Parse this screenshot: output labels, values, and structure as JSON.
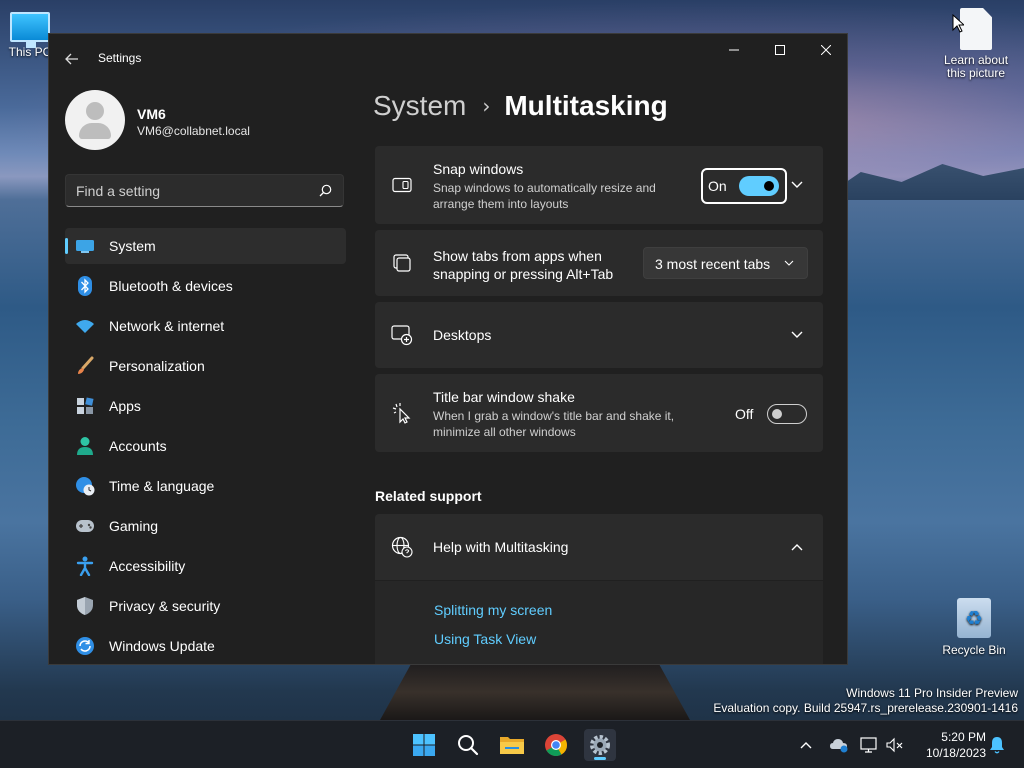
{
  "desktop": {
    "icons": [
      {
        "label": "This PC"
      },
      {
        "label": "Learn about this picture"
      },
      {
        "label": "Recycle Bin"
      }
    ],
    "watermark_line1": "Windows 11 Pro Insider Preview",
    "watermark_line2": "Evaluation copy. Build 25947.rs_prerelease.230901-1416"
  },
  "window": {
    "title": "Settings",
    "profile": {
      "name": "VM6",
      "email": "VM6@collabnet.local"
    },
    "search": {
      "placeholder": "Find a setting"
    },
    "nav": [
      {
        "label": "System",
        "icon": "monitor-icon",
        "active": true
      },
      {
        "label": "Bluetooth & devices",
        "icon": "bluetooth-icon"
      },
      {
        "label": "Network & internet",
        "icon": "wifi-icon"
      },
      {
        "label": "Personalization",
        "icon": "paintbrush-icon"
      },
      {
        "label": "Apps",
        "icon": "apps-icon"
      },
      {
        "label": "Accounts",
        "icon": "person-icon"
      },
      {
        "label": "Time & language",
        "icon": "globe-clock-icon"
      },
      {
        "label": "Gaming",
        "icon": "gamepad-icon"
      },
      {
        "label": "Accessibility",
        "icon": "accessibility-icon"
      },
      {
        "label": "Privacy & security",
        "icon": "shield-icon"
      },
      {
        "label": "Windows Update",
        "icon": "update-icon"
      }
    ],
    "breadcrumb": {
      "parent": "System",
      "separator": "›",
      "current": "Multitasking"
    },
    "settings": {
      "snap": {
        "title": "Snap windows",
        "desc_line1": "Snap windows to automatically resize and",
        "desc_line2": "arrange them into layouts",
        "state_label": "On",
        "enabled": true
      },
      "tabs": {
        "title_line1": "Show tabs from apps when",
        "title_line2": "snapping or pressing Alt+Tab",
        "selected": "3 most recent tabs"
      },
      "desktops": {
        "title": "Desktops"
      },
      "shake": {
        "title": "Title bar window shake",
        "desc_line1": "When I grab a window's title bar and shake it,",
        "desc_line2": "minimize all other windows",
        "state_label": "Off",
        "enabled": false
      }
    },
    "related": {
      "heading": "Related support",
      "help_title": "Help with Multitasking",
      "links": [
        "Splitting my screen",
        "Using Task View"
      ]
    }
  },
  "taskbar": {
    "apps": [
      "start-icon",
      "search-icon",
      "file-explorer-icon",
      "chrome-icon",
      "settings-icon"
    ],
    "time": "5:20 PM",
    "date": "10/18/2023"
  },
  "colors": {
    "accent": "#60cdff",
    "window_bg": "#202020",
    "card_bg": "#2b2b2b",
    "taskbar_bg": "#1c2026"
  }
}
